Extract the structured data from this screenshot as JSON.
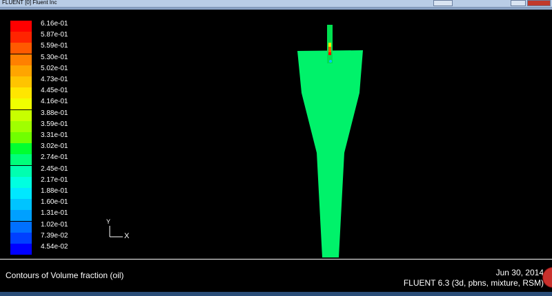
{
  "window": {
    "title": "FLUENT [0] Fluent Inc"
  },
  "legend": {
    "levels": [
      {
        "label": "6.16e-01",
        "color": "#ff0000"
      },
      {
        "label": "5.87e-01",
        "color": "#ff2400"
      },
      {
        "label": "5.59e-01",
        "color": "#ff5a00"
      },
      {
        "label": "5.30e-01",
        "color": "#ff8000"
      },
      {
        "label": "5.02e-01",
        "color": "#ffa500"
      },
      {
        "label": "4.73e-01",
        "color": "#ffc400"
      },
      {
        "label": "4.45e-01",
        "color": "#ffe600"
      },
      {
        "label": "4.16e-01",
        "color": "#f0ff00"
      },
      {
        "label": "3.88e-01",
        "color": "#c8ff00"
      },
      {
        "label": "3.59e-01",
        "color": "#a0ff00"
      },
      {
        "label": "3.31e-01",
        "color": "#70ff00"
      },
      {
        "label": "3.02e-01",
        "color": "#00ff30"
      },
      {
        "label": "2.74e-01",
        "color": "#00ff7a"
      },
      {
        "label": "2.45e-01",
        "color": "#00ffb0"
      },
      {
        "label": "2.17e-01",
        "color": "#00ffe0"
      },
      {
        "label": "1.88e-01",
        "color": "#00e8ff"
      },
      {
        "label": "1.60e-01",
        "color": "#00c4ff"
      },
      {
        "label": "1.31e-01",
        "color": "#00a0ff"
      },
      {
        "label": "1.02e-01",
        "color": "#0070ff"
      },
      {
        "label": "7.39e-02",
        "color": "#0040ff"
      },
      {
        "label": "4.54e-02",
        "color": "#0000ff"
      }
    ]
  },
  "axes": {
    "y_label": "Y",
    "x_label": "X"
  },
  "geometry": {
    "body_color": "#00f26a"
  },
  "infobar": {
    "caption": "Contours of Volume fraction (oil)",
    "date": "Jun 30, 2014",
    "version": "FLUENT 6.3 (3d, pbns, mixture, RSM)"
  }
}
